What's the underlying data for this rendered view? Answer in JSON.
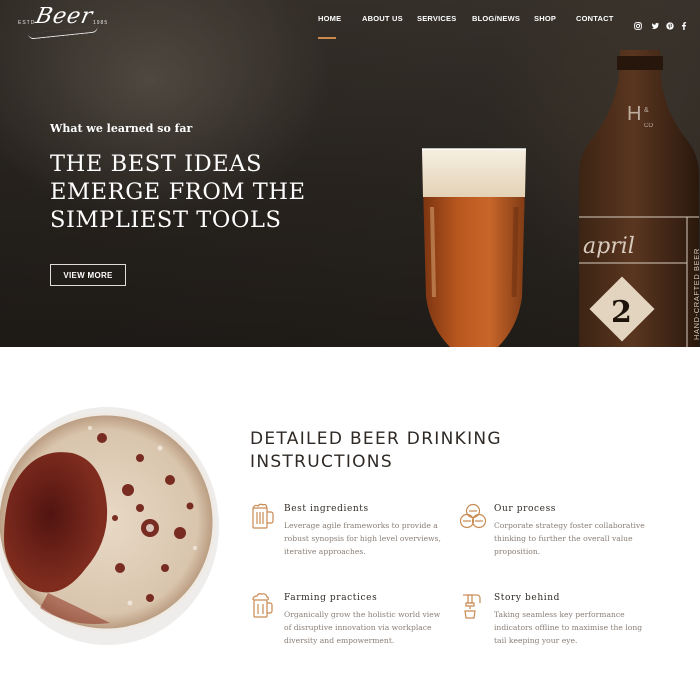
{
  "header": {
    "logo": {
      "word": "Beer",
      "estd": "ESTD",
      "year": "1985"
    },
    "nav": [
      {
        "label": "HOME",
        "active": true
      },
      {
        "label": "ABOUT US"
      },
      {
        "label": "SERVICES"
      },
      {
        "label": "BLOG/NEWS"
      },
      {
        "label": "SHOP"
      },
      {
        "label": "CONTACT"
      }
    ],
    "social": [
      "instagram-icon",
      "twitter-icon",
      "pinterest-icon",
      "facebook-icon"
    ],
    "accent": "#c98a52"
  },
  "hero": {
    "kicker": "What we learned so far",
    "title_lines": [
      "THE BEST IDEAS",
      "EMERGE FROM THE",
      "SIMPLIEST TOOLS"
    ],
    "button_label": "VIEW MORE",
    "bottle": {
      "brand": "H&CO",
      "label_script": "april",
      "label_side": "HAND-CRAFTED BEER",
      "number": "2"
    }
  },
  "section": {
    "title_lines": [
      "DETAILED BEER DRINKING",
      "INSTRUCTIONS"
    ],
    "features": [
      {
        "icon": "beer-mug-icon",
        "title": "Best ingredients",
        "text": "Leverage agile frameworks to provide a robust synopsis for high level overviews, iterative approaches."
      },
      {
        "icon": "barrels-icon",
        "title": "Our process",
        "text": "Corporate strategy foster collaborative thinking to further the overall value proposition."
      },
      {
        "icon": "foamy-mug-icon",
        "title": "Farming practices",
        "text": "Organically grow the holistic world view of disruptive innovation via workplace diversity and empowerment."
      },
      {
        "icon": "beer-tap-icon",
        "title": "Story behind",
        "text": "Taking seamless key performance indicators offline to maximise the long tail keeping your eye."
      }
    ]
  }
}
